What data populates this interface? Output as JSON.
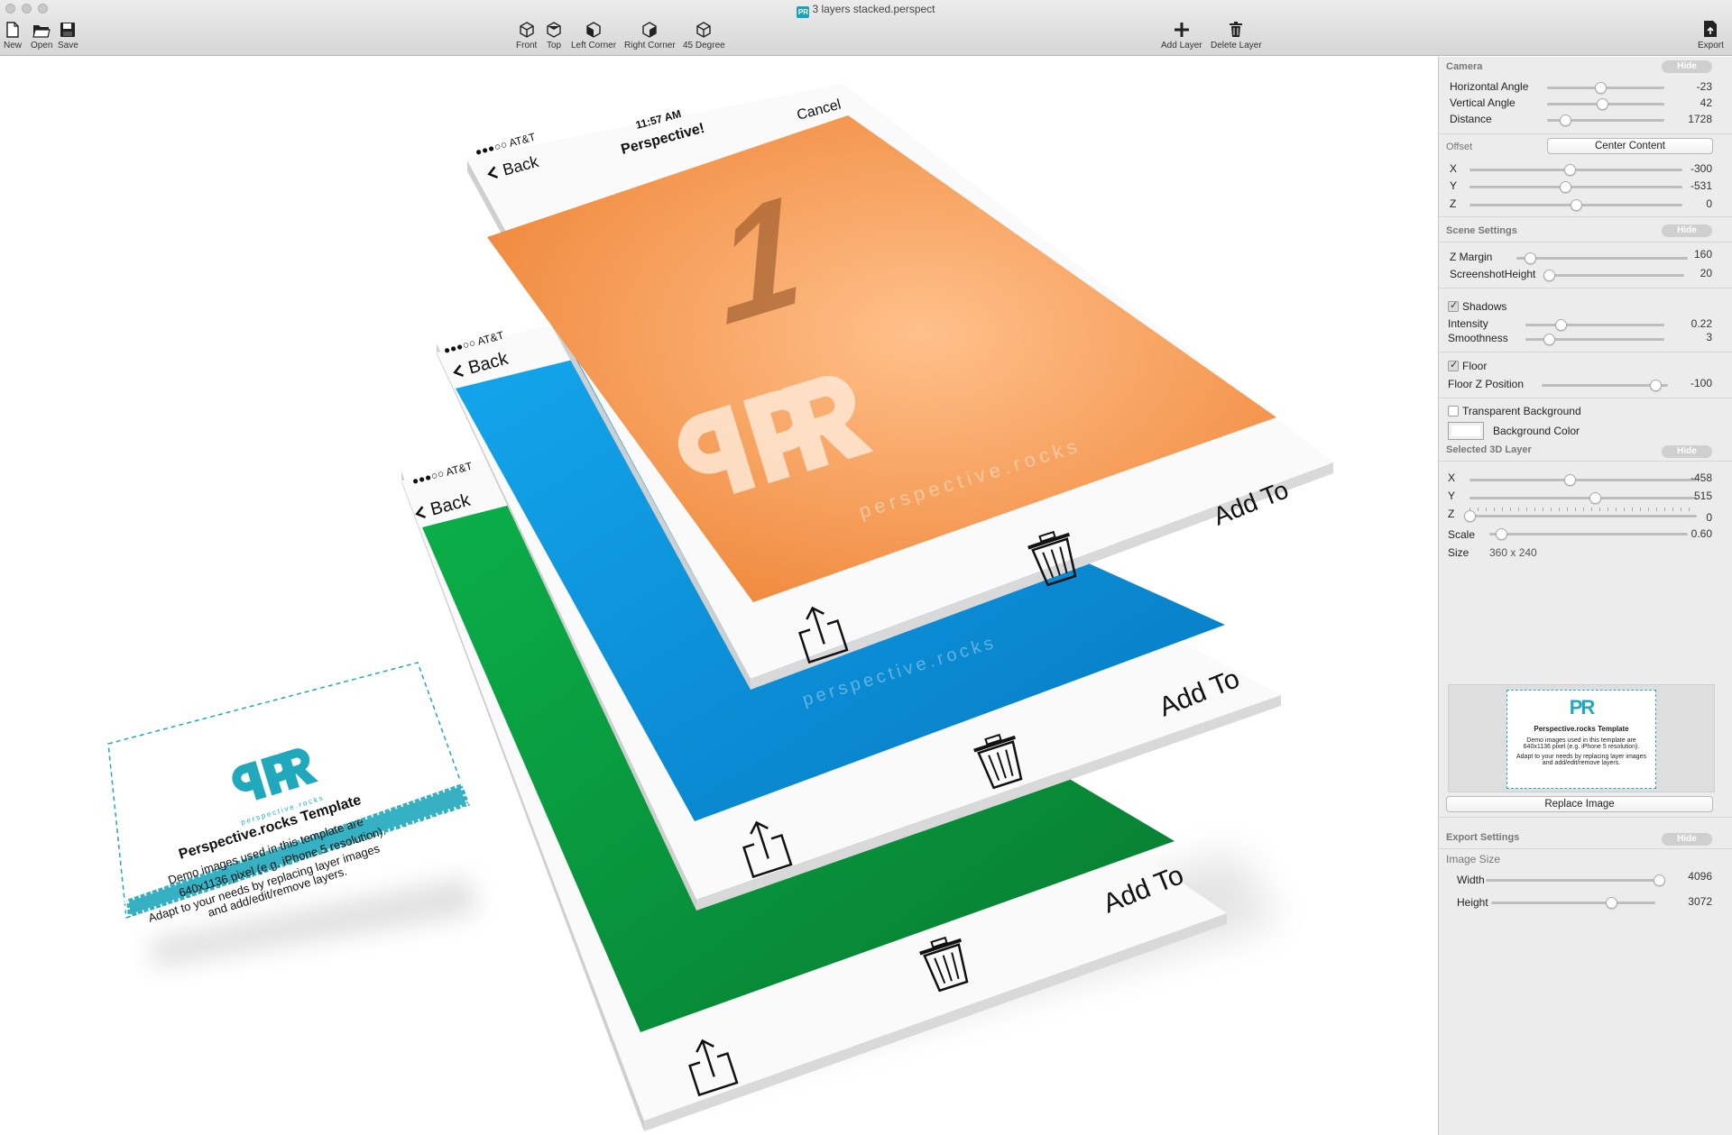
{
  "window": {
    "title": "3 layers stacked.perspect",
    "file_icon": "perspective-doc-icon"
  },
  "toolbar": {
    "new": "New",
    "open": "Open",
    "save": "Save",
    "front": "Front",
    "top": "Top",
    "left_corner": "Left Corner",
    "right_corner": "Right Corner",
    "degree45": "45 Degree",
    "add_layer": "Add Layer",
    "delete_layer": "Delete Layer",
    "export": "Export"
  },
  "canvas": {
    "phones": [
      {
        "color": "#f08c46",
        "status_left": "●●●○○ AT&T",
        "time": "11:57 AM",
        "nav_back": "Back",
        "nav_title": "Perspective!",
        "nav_right": "Cancel",
        "big_number": "1",
        "watermark": "perspective.rocks",
        "add_to": "Add To"
      },
      {
        "color": "#0a8fd5",
        "status_left": "●●●○○ AT&T",
        "nav_back": "Back",
        "watermark": "perspective.rocks",
        "add_to": "Add To"
      },
      {
        "color": "#07963a",
        "status_left": "●●●○○ AT&T",
        "nav_back": "Back",
        "add_to": "Add To"
      }
    ],
    "card": {
      "logo_sub": "perspective.rocks",
      "title": "Perspective.rocks Template",
      "lines": [
        "Demo images used in this template are",
        "640x1136 pixel (e.g. iPhone 5 resolution).",
        "Adapt to your needs by replacing layer images",
        "and add/edit/remove layers."
      ]
    }
  },
  "panel": {
    "camera": {
      "header": "Camera",
      "hide": "Hide",
      "rows": [
        {
          "label": "Horizontal Angle",
          "value": "-23",
          "pos": 0.45
        },
        {
          "label": "Vertical Angle",
          "value": "42",
          "pos": 0.47
        },
        {
          "label": "Distance",
          "value": "1728",
          "pos": 0.15
        }
      ]
    },
    "offset": {
      "header": "Offset",
      "center_button": "Center Content",
      "rows": [
        {
          "label": "X",
          "value": "-300",
          "pos": 0.47
        },
        {
          "label": "Y",
          "value": "-531",
          "pos": 0.45
        },
        {
          "label": "Z",
          "value": "0",
          "pos": 0.5
        }
      ]
    },
    "scene": {
      "header": "Scene Settings",
      "hide": "Hide",
      "rows": [
        {
          "label": "Z Margin",
          "value": "160",
          "pos": 0.08
        },
        {
          "label": "ScreenshotHeight",
          "value": "20",
          "pos": 0.01
        }
      ]
    },
    "shadows": {
      "label": "Shadows",
      "checked": true,
      "rows": [
        {
          "label": "Intensity",
          "value": "0.22",
          "pos": 0.25
        },
        {
          "label": "Smoothness",
          "value": "3",
          "pos": 0.17
        }
      ]
    },
    "floor": {
      "label": "Floor",
      "checked": true,
      "rows": [
        {
          "label": "Floor Z Position",
          "value": "-100",
          "pos": 0.9
        }
      ]
    },
    "transparent_bg": {
      "label": "Transparent Background",
      "checked": false
    },
    "bg_color": {
      "label": "Background Color",
      "color": "#ffffff"
    },
    "layer": {
      "header": "Selected 3D Layer",
      "hide": "Hide",
      "rows": [
        {
          "label": "X",
          "value": "-458",
          "pos": 0.44
        },
        {
          "label": "Y",
          "value": "515",
          "pos": 0.55
        },
        {
          "label": "Z",
          "value": "0",
          "pos": 0.0
        },
        {
          "label": "Scale",
          "value": "0.60",
          "pos": 0.06
        }
      ],
      "size_label": "Size",
      "size_value": "360 x 240",
      "preview": {
        "logo": "PR",
        "title": "Perspective.rocks Template",
        "lines": [
          "Demo images used in this template are",
          "640x1136 pixel (e.g. iPhone 5 resolution).",
          "Adapt to your needs by replacing layer images",
          "and add/edit/remove layers."
        ]
      },
      "replace_button": "Replace Image"
    },
    "export": {
      "header": "Export Settings",
      "hide": "Hide",
      "image_size": "Image Size",
      "rows": [
        {
          "label": "Width",
          "value": "4096",
          "pos": 0.98
        },
        {
          "label": "Height",
          "value": "3072",
          "pos": 0.73
        }
      ]
    }
  }
}
